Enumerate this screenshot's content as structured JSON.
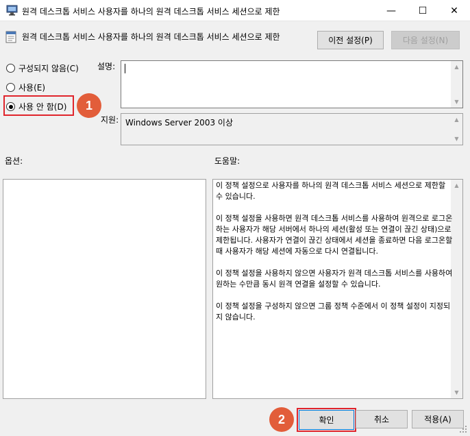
{
  "window": {
    "title": "원격 데스크톱 서비스 사용자를 하나의 원격 데스크톱 서비스 세션으로 제한",
    "min_glyph": "—",
    "max_glyph": "☐",
    "close_glyph": "✕"
  },
  "header": {
    "policy_name": "원격 데스크톱 서비스 사용자를 하나의 원격 데스크톱 서비스 세션으로 제한",
    "prev_setting_label": "이전 설정(P)",
    "next_setting_label": "다음 설정(N)"
  },
  "options": {
    "items": [
      {
        "label": "구성되지 않음(C)",
        "checked": false
      },
      {
        "label": "사용(E)",
        "checked": false
      },
      {
        "label": "사용 안 함(D)",
        "checked": true
      }
    ]
  },
  "callouts": {
    "first": "1",
    "second": "2"
  },
  "comment": {
    "label": "설명:",
    "value": ""
  },
  "supported": {
    "label": "지원:",
    "value": "Windows Server 2003 이상"
  },
  "panes": {
    "options_label": "옵션:",
    "help_label": "도움말:"
  },
  "help": {
    "paragraphs": [
      "이 정책 설정으로 사용자를 하나의 원격 데스크톱 서비스 세션으로 제한할 수 있습니다.",
      "이 정책 설정을 사용하면 원격 데스크톱 서비스를 사용하여 원격으로 로그온하는 사용자가 해당 서버에서 하나의 세션(활성 또는 연결이 끊긴 상태)으로 제한됩니다. 사용자가 연결이 끊긴 상태에서 세션을 종료하면 다음 로그온할 때 사용자가 해당 세션에 자동으로 다시 연결됩니다.",
      "이 정책 설정을 사용하지 않으면 사용자가 원격 데스크톱 서비스를 사용하여 원하는 수만큼 동시 원격 연결을 설정할 수 있습니다.",
      "이 정책 설정을 구성하지 않으면 그룹 정책 수준에서 이 정책 설정이 지정되지 않습니다."
    ]
  },
  "footer": {
    "ok_label": "확인",
    "cancel_label": "취소",
    "apply_label": "적용(A)"
  },
  "colors": {
    "highlight": "#e0242b",
    "badge": "#e25d3a",
    "focus": "#0078d7"
  }
}
